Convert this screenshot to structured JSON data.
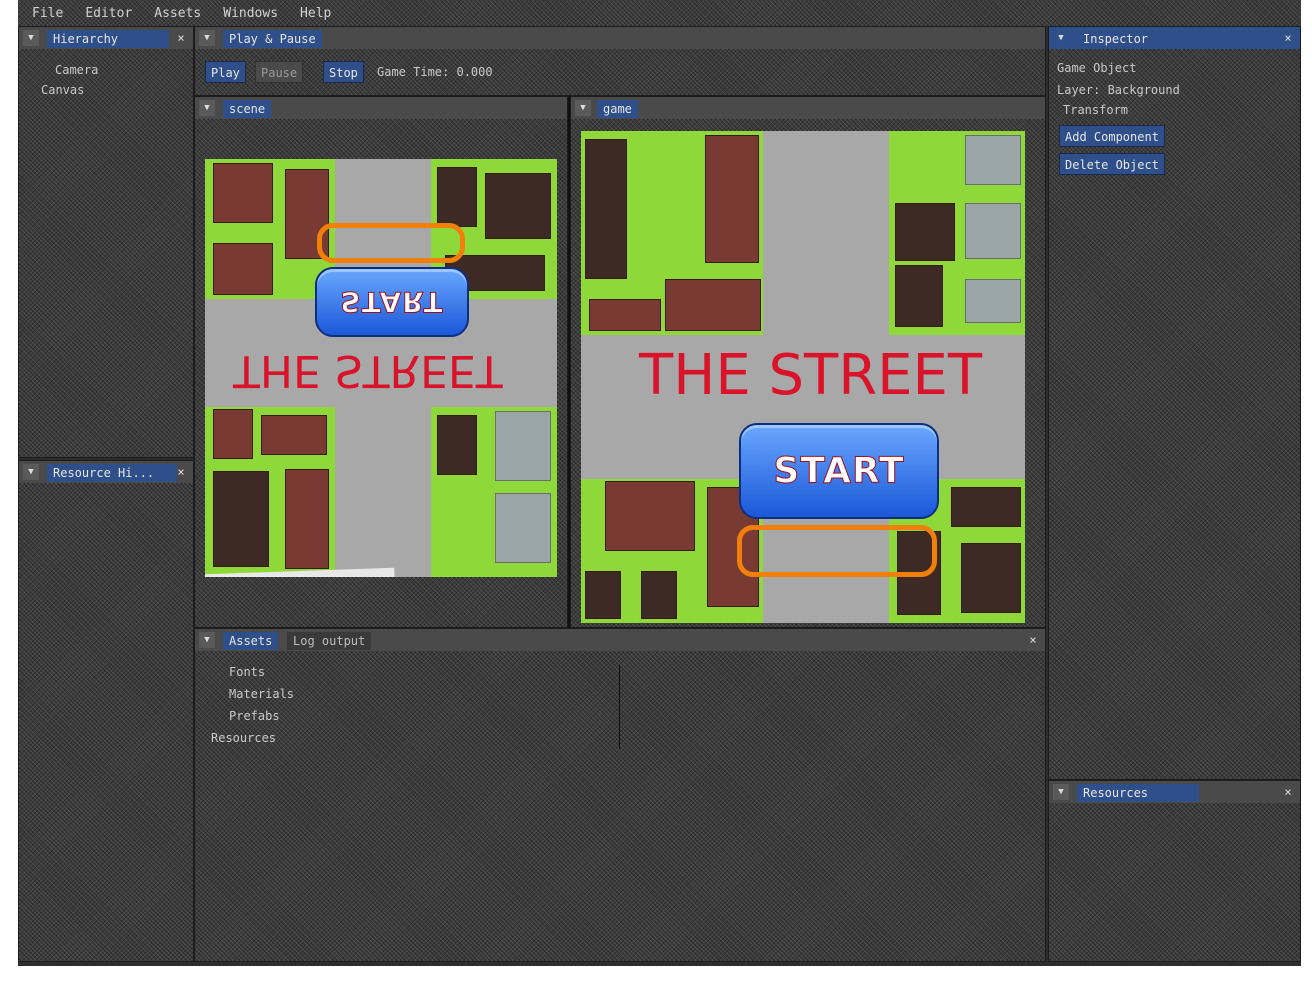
{
  "menu": [
    "File",
    "Editor",
    "Assets",
    "Windows",
    "Help"
  ],
  "hierarchy": {
    "title": "Hierarchy",
    "items": [
      "Camera",
      "Canvas"
    ]
  },
  "resource_hierarchy": {
    "title": "Resource Hi..."
  },
  "play_pause": {
    "title": "Play & Pause",
    "play_label": "Play",
    "pause_label": "Pause",
    "stop_label": "Stop",
    "time_label": "Game Time: 0.000"
  },
  "scene": {
    "title": "scene",
    "start_text": "START",
    "street_text": "THE STREET"
  },
  "game": {
    "title": "game",
    "start_text": "START",
    "street_text": "THE STREET"
  },
  "assets": {
    "tabs": [
      "Assets",
      "Log output"
    ],
    "folders": [
      "Fonts",
      "Materials",
      "Prefabs",
      "Resources"
    ]
  },
  "inspector": {
    "title": "Inspector",
    "rows": [
      "Game Object",
      "Layer: Background",
      "Transform"
    ],
    "add_component_label": "Add Component",
    "delete_object_label": "Delete Object"
  },
  "resources": {
    "title": "Resources"
  },
  "colors": {
    "panel_bg": "#3a3a3a",
    "tab_accent": "#2f4f8a",
    "grass": "#8fd83a",
    "road": "#a8a8a8",
    "title_red": "#d8132a",
    "ring_orange": "#f0800a"
  }
}
